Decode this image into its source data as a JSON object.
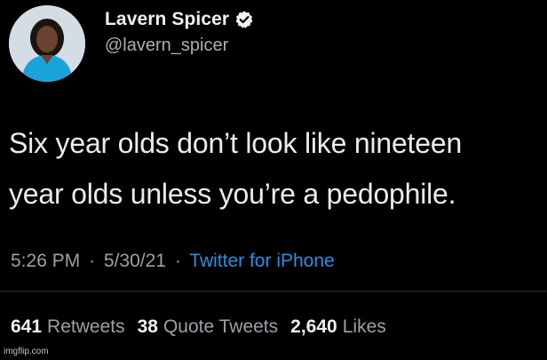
{
  "user": {
    "display_name": "Lavern Spicer",
    "handle": "@lavern_spicer",
    "verified_icon": "verified-badge-icon",
    "avatar_icon": "profile-photo"
  },
  "tweet": {
    "lines": [
      "Six year olds don’t look like nineteen",
      "year olds unless you’re a pedophile."
    ]
  },
  "meta": {
    "time": "5:26 PM",
    "date": "5/30/21",
    "source": "Twitter for iPhone",
    "separator": "·"
  },
  "stats": {
    "retweets_count": "641",
    "retweets_label": "Retweets",
    "quotes_count": "38",
    "quotes_label": "Quote Tweets",
    "likes_count": "2,640",
    "likes_label": "Likes"
  },
  "watermark": "imgflip.com",
  "colors": {
    "background": "#000000",
    "text": "#e7e9ea",
    "secondary": "#9aa1a6",
    "link": "#2b8fe0"
  }
}
